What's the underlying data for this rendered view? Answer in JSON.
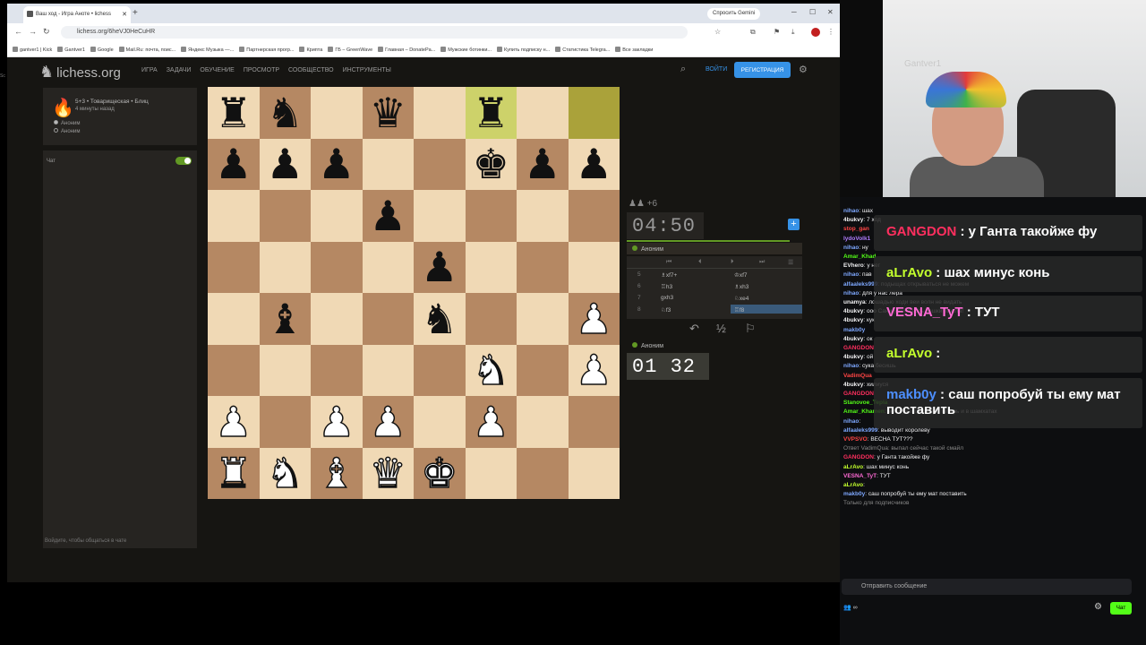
{
  "browser": {
    "tab_title": "Ваш ход - Игра Аноте • lichess",
    "url": "lichess.org/6heVJ0HeCuHR",
    "gemini_label": "Спросить Gemini",
    "bookmarks": [
      "gantver1 | Kick",
      "Gantver1",
      "Google",
      "Mail.Ru: почта, поис...",
      "Яндекс Музыка —...",
      "Партнерская прогр...",
      "Крипта",
      "ГБ ‒ GreenWave",
      "Главная ‒ DonatePa...",
      "Мужские ботинки...",
      "Купить подписку н...",
      "Статистика Telegra...",
      "Все закладки"
    ]
  },
  "lichess": {
    "logo": "lichess.org",
    "nav": [
      "ИГРА",
      "ЗАДАЧИ",
      "ОБУЧЕНИЕ",
      "ПРОСМОТР",
      "СООБЩЕСТВО",
      "ИНСТРУМЕНТЫ"
    ],
    "login": "ВОЙТИ",
    "signup": "РЕГИСТРАЦИЯ",
    "game_title": "5+3 • Товарищеская • Блиц",
    "game_ago": "4 минуты назад",
    "players": [
      "Аноним",
      "Аноним"
    ],
    "chat_label": "Чат",
    "chat_footer": "Войдите, чтобы общаться в чате",
    "clock_top": "04:50",
    "clock_bottom": "01 32",
    "captured": "♟♟ +6",
    "top_player": "Аноним",
    "bottom_player": "Аноним",
    "moves": [
      {
        "n": "5",
        "w": "♗xf7+",
        "b": "♔xf7",
        "cur": false
      },
      {
        "n": "6",
        "w": "♖h3",
        "b": "♗xh3",
        "cur": false
      },
      {
        "n": "7",
        "w": "gxh3",
        "b": "♘xe4",
        "cur": false
      },
      {
        "n": "8",
        "w": "♘f3",
        "b": "♖f8",
        "cur": true
      }
    ],
    "move_controls": [
      "⏮",
      "⏴",
      "⏵",
      "⏭",
      "☰"
    ],
    "actions": [
      "↶",
      "½",
      "⚐"
    ]
  },
  "board": [
    [
      "br",
      "bn",
      "",
      "bq",
      "",
      "br",
      "",
      "hl"
    ],
    [
      "bp",
      "bp",
      "bp",
      "",
      "",
      "bk",
      "bp",
      "bp"
    ],
    [
      "",
      "",
      "",
      "bp",
      "",
      "",
      "",
      ""
    ],
    [
      "",
      "",
      "",
      "",
      "bp",
      "",
      "",
      ""
    ],
    [
      "",
      "bb",
      "",
      "",
      "bn",
      "",
      "",
      "wp"
    ],
    [
      "",
      "",
      "",
      "",
      "",
      "wn",
      "",
      "wp"
    ],
    [
      "wp",
      "",
      "wp",
      "wp",
      "",
      "wp",
      "",
      ""
    ],
    [
      "wr",
      "wn",
      "wb",
      "wq",
      "wk",
      "",
      "",
      ""
    ]
  ],
  "stream": {
    "cam_brand": "Gantver1",
    "overlays": [
      {
        "user": "GANGDON",
        "text": " : у Ганта такойже фу",
        "color": "#ff2f5f"
      },
      {
        "user": "aLrAvo",
        "text": " : шах минус конь",
        "color": "#c3ff2d"
      },
      {
        "user": "VESNA_TyT",
        "text": " : ТУТ",
        "color": "#ff6ad5"
      },
      {
        "user": "aLrAvo",
        "text": " : ",
        "color": "#c3ff2d"
      },
      {
        "user": "makb0y",
        "text": " : саш попробуй ты ему мат поставить",
        "color": "#4d8fff"
      }
    ],
    "messages": [
      {
        "user": "nihao",
        "text": ": шах",
        "color": "#7ea8ff"
      },
      {
        "user": "4bukvy",
        "text": ": 7 ход",
        "color": "#efeff1"
      },
      {
        "user": "stop_gan",
        "text": "",
        "color": "#ff4545"
      },
      {
        "user": "lydoVolk1",
        "text": "",
        "color": "#b07cff"
      },
      {
        "user": "nihao",
        "text": ": ну",
        "color": "#7ea8ff"
      },
      {
        "user": "Amar_Khad",
        "text": "",
        "color": "#53fc18"
      },
      {
        "user": "EVhero",
        "text": ": у нег",
        "color": "#efeff1"
      },
      {
        "user": "nihao",
        "text": ": пав",
        "color": "#7ea8ff"
      },
      {
        "user": "alfaaleks999",
        "text": ": подыщах открываться не можем",
        "color": "#7ea8ff"
      },
      {
        "user": "nihao",
        "text": ": для у нас лера",
        "color": "#7ea8ff"
      },
      {
        "user": "unamya",
        "text": ": лошадью ходи веи волн не видать",
        "color": "#efeff1"
      },
      {
        "user": "4bukvy",
        "text": ": ооо Сани у тебя есть пешки пахота!",
        "color": "#efeff1"
      },
      {
        "user": "4bukvy",
        "text": ": кук",
        "color": "#efeff1"
      },
      {
        "user": "makb0y",
        "text": "",
        "color": "#7ea8ff"
      },
      {
        "user": "4bukvy",
        "text": ": ок",
        "color": "#efeff1"
      },
      {
        "user": "GANGDON",
        "text": "",
        "color": "#ff2f5f"
      },
      {
        "user": "4bukvy",
        "text": ": ой",
        "color": "#efeff1"
      },
      {
        "user": "nihao",
        "text": ": сука бесишь",
        "color": "#7ea8ff"
      },
      {
        "user": "VadimQua",
        "text": "",
        "color": "#ff4545"
      },
      {
        "user": "4bukvy",
        "text": ": хилиуся",
        "color": "#efeff1"
      },
      {
        "user": "GANGDON",
        "text": "",
        "color": "#ff2f5f"
      },
      {
        "user": "Stanovoe_Tepla",
        "text": "",
        "color": "#53fc18"
      },
      {
        "user": "Amar_Khamen",
        "text": ": если уже т, кс ебут, теперь и в шамхатах",
        "color": "#53fc18"
      },
      {
        "user": "nihao",
        "text": ":",
        "color": "#7ea8ff"
      },
      {
        "user": "alfaaleks999",
        "text": ": выводит королеву",
        "color": "#7ea8ff"
      },
      {
        "user": "VVPSVO",
        "text": ": ВЕСНА ТУТ???",
        "color": "#ff4545"
      },
      {
        "user": "",
        "text": "Ответ VadimQua: выпал сейчас такой смайл",
        "color": "#888888"
      },
      {
        "user": "GANGDON",
        "text": ": у Ганта такойже фу",
        "color": "#ff2f5f"
      },
      {
        "user": "aLrAvo",
        "text": ": шах минус конь",
        "color": "#c3ff2d"
      },
      {
        "user": "VESNA_TyT",
        "text": ": ТУТ",
        "color": "#ff6ad5"
      },
      {
        "user": "aLrAvo",
        "text": ":",
        "color": "#c3ff2d"
      },
      {
        "user": "makb0y",
        "text": ": саш попробуй ты ему мат поставить",
        "color": "#7ea8ff"
      },
      {
        "user": "",
        "text": "Только для подписчиков",
        "color": "#888888"
      }
    ],
    "input_placeholder": "Отправить сообщение",
    "chat_button": "Чат",
    "viewers": "∞"
  }
}
